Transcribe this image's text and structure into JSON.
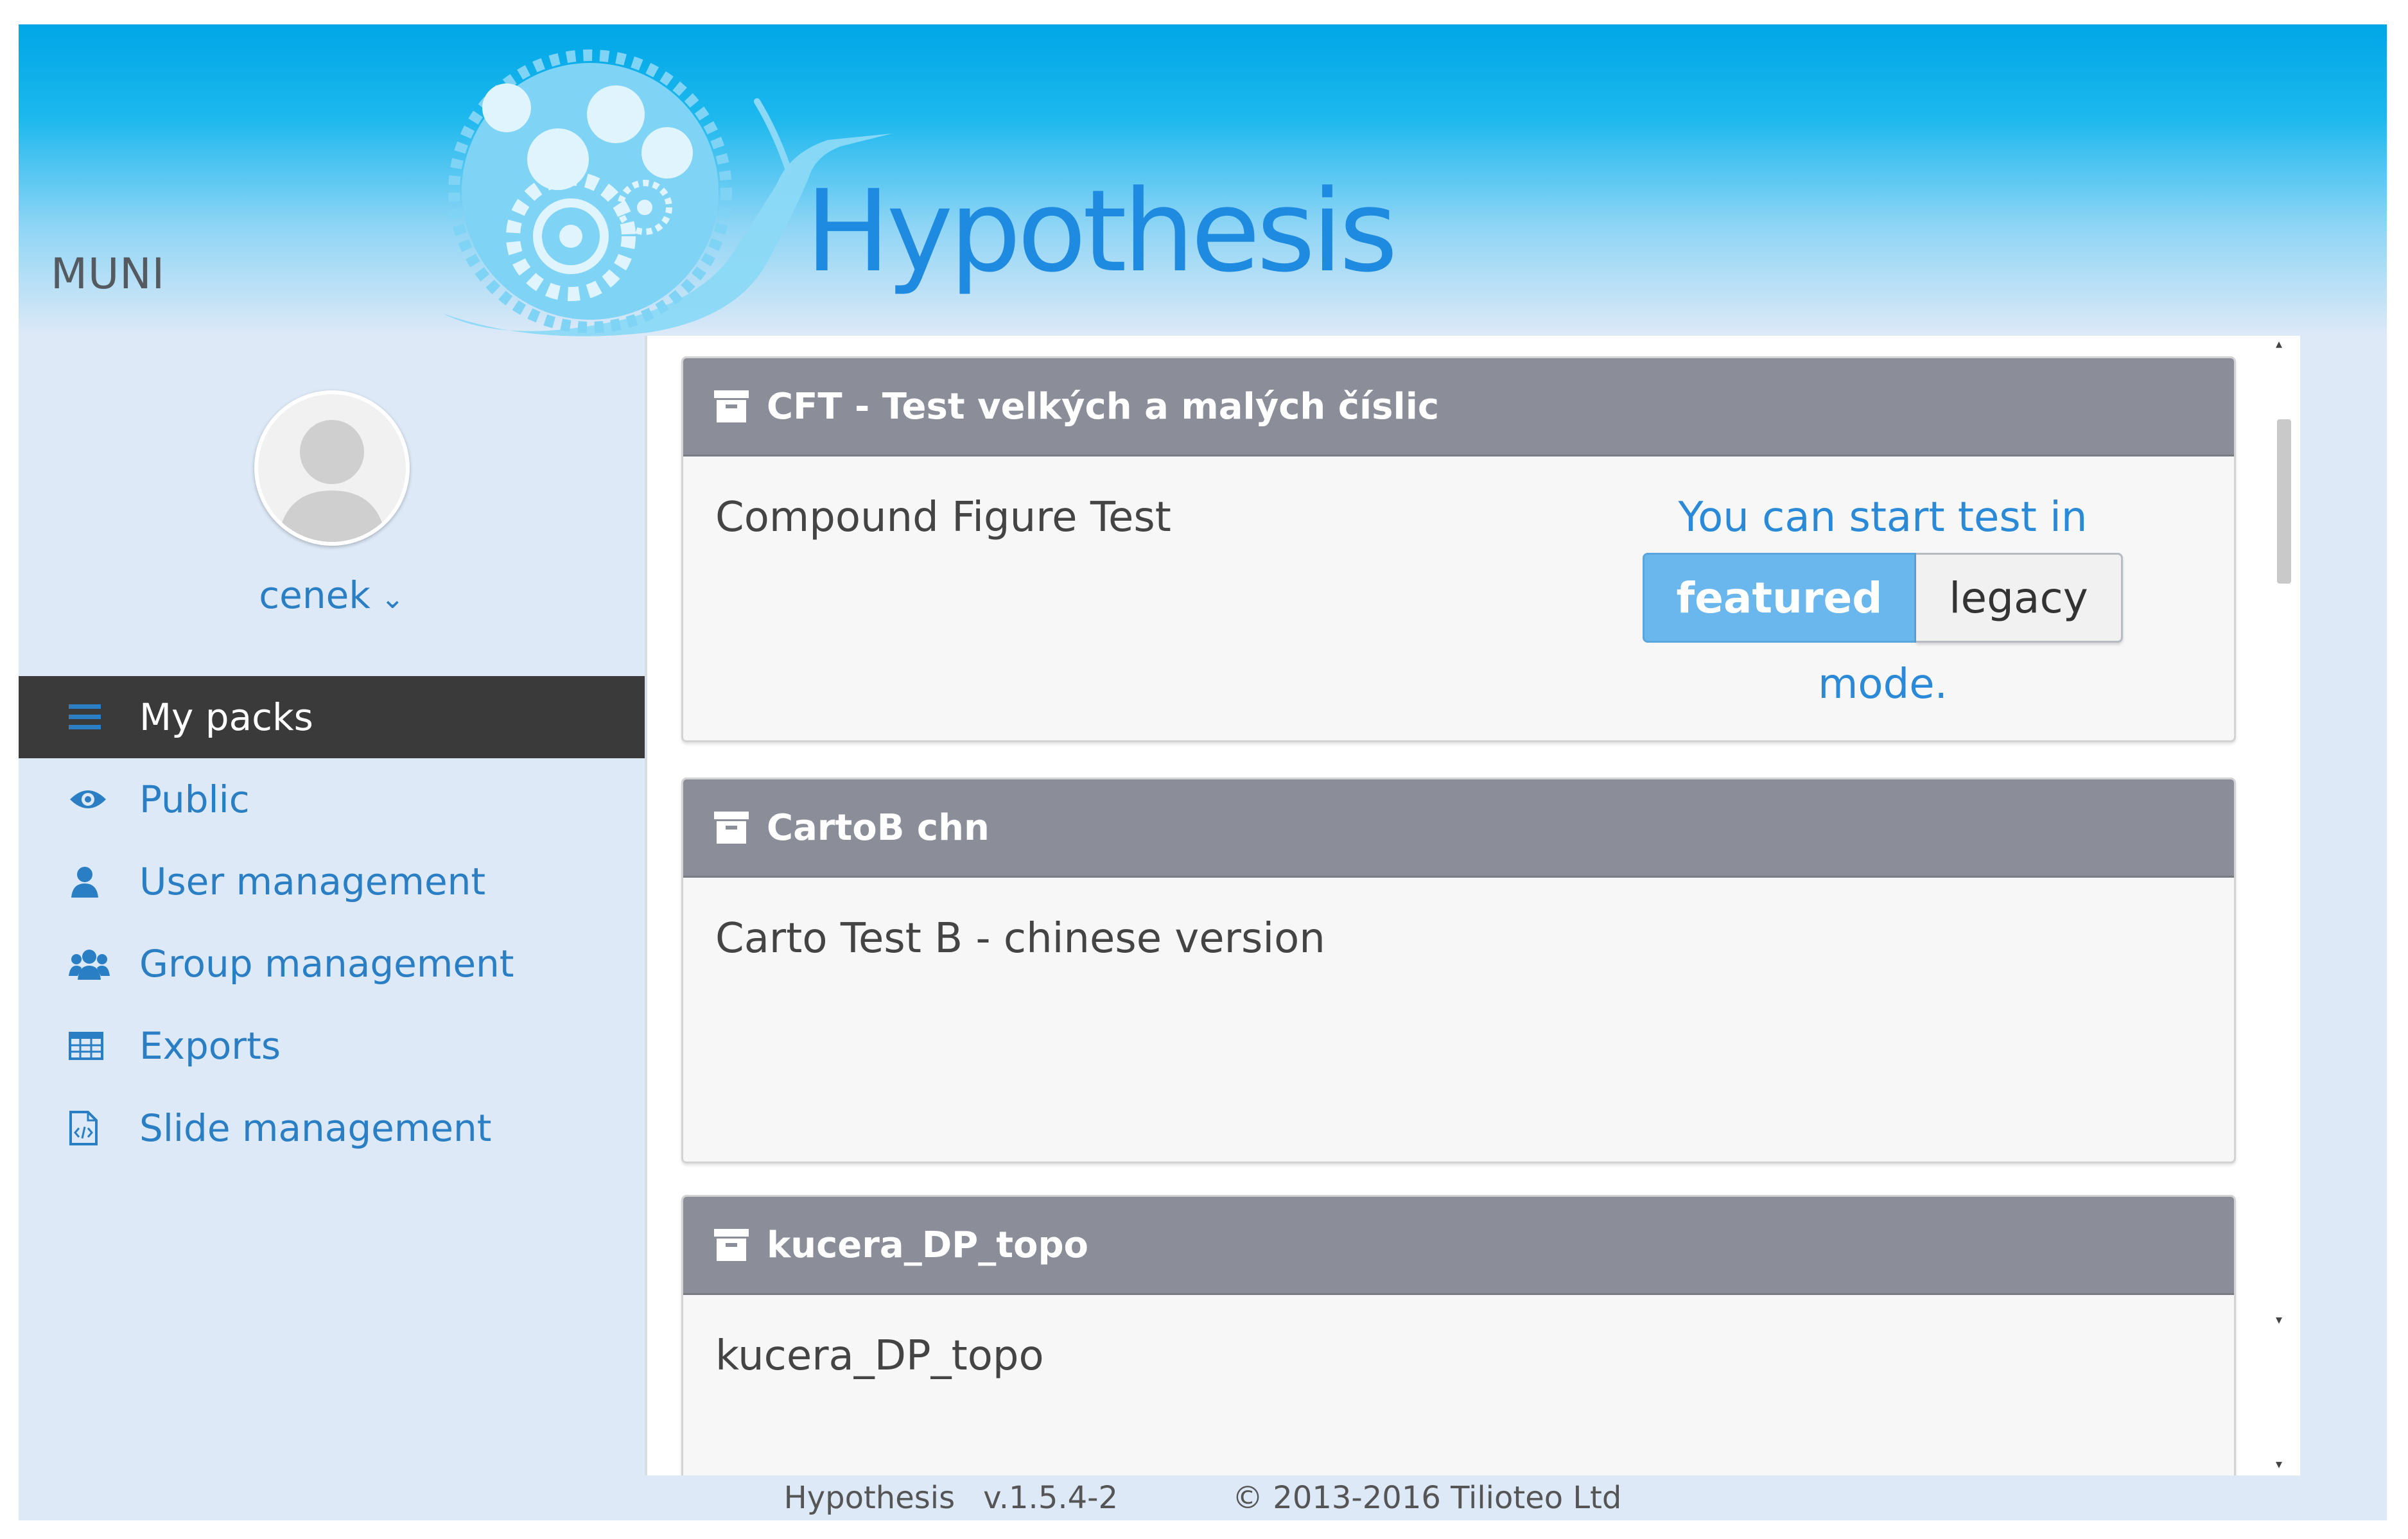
{
  "header": {
    "org_name": "MUNI",
    "app_title": "Hypothesis"
  },
  "user": {
    "name": "cenek"
  },
  "nav": {
    "items": [
      {
        "label": "My packs",
        "icon": "list-icon",
        "active": true
      },
      {
        "label": "Public",
        "icon": "eye-icon"
      },
      {
        "label": "User management",
        "icon": "user-icon"
      },
      {
        "label": "Group management",
        "icon": "users-icon"
      },
      {
        "label": "Exports",
        "icon": "table-icon"
      },
      {
        "label": "Slide management",
        "icon": "file-code-icon"
      }
    ]
  },
  "packs": [
    {
      "title": "CFT - Test velkých a malých číslic",
      "description": "Compound Figure Test",
      "start_prompt": "You can start test in",
      "featured_label": "featured",
      "legacy_label": "legacy",
      "mode_suffix": "mode."
    },
    {
      "title": "CartoB chn",
      "description": "Carto Test B - chinese version"
    },
    {
      "title": "kucera_DP_topo",
      "description": "kucera_DP_topo"
    }
  ],
  "footer": {
    "app_name": "Hypothesis",
    "version": "v.1.5.4-2",
    "copyright": "© 2013-2016 Tilioteo Ltd"
  },
  "colors": {
    "header_top": "#00a6e6",
    "accent": "#2a7fc4",
    "card_header": "#8b8e98",
    "featured_button": "#6ab7ee",
    "active_nav": "#3a3a3a"
  }
}
